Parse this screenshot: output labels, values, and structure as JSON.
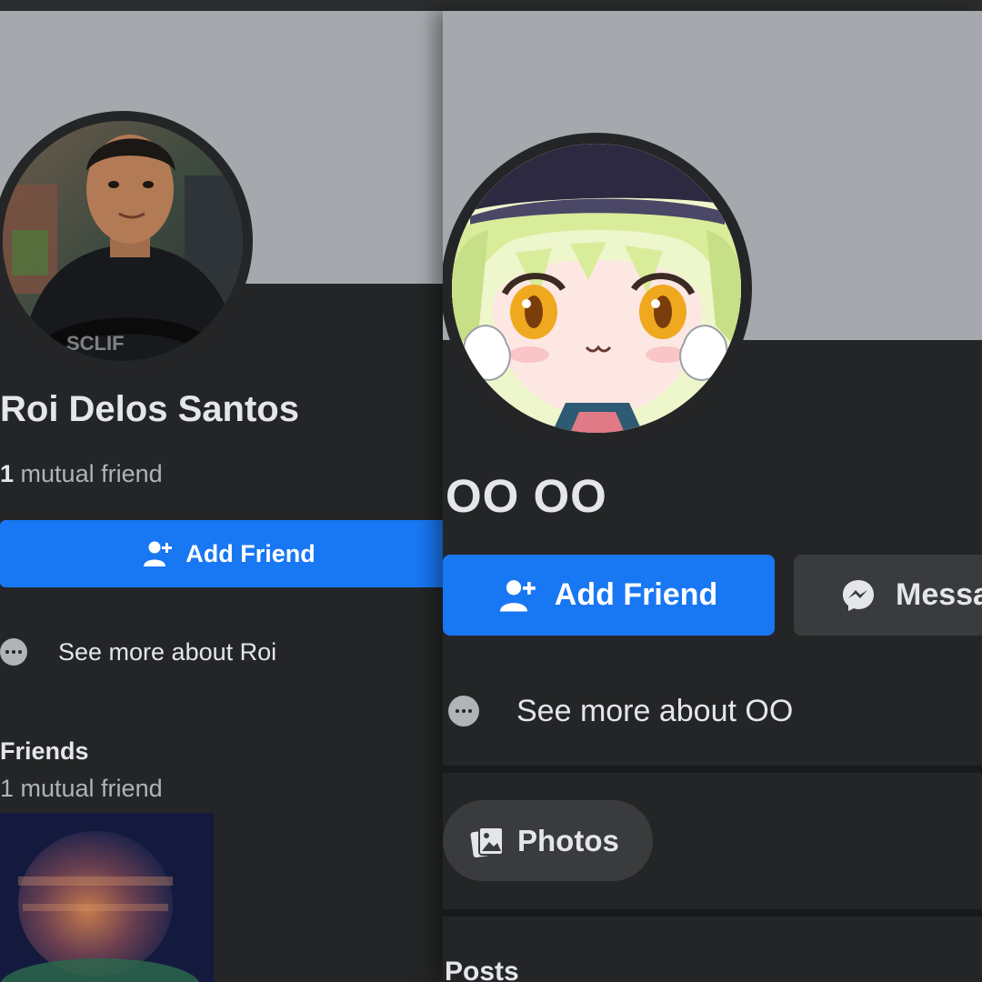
{
  "left_profile": {
    "name": "Roi Delos Santos",
    "mutual_count": "1",
    "mutual_text": "mutual friend",
    "add_friend_label": "Add Friend",
    "see_more_label": "See more about Roi",
    "friends_heading": "Friends",
    "friends_sub": "1 mutual friend"
  },
  "right_profile": {
    "name": "OO OO",
    "add_friend_label": "Add Friend",
    "message_label": "Messa",
    "see_more_label": "See more about OO",
    "photos_label": "Photos",
    "posts_heading": "Posts"
  },
  "colors": {
    "accent": "#1877f2",
    "background": "#242526",
    "cover": "#a5a8ad",
    "secondary_button": "#3a3b3c",
    "text_primary": "#e4e6eb",
    "text_secondary": "#b0b3b8"
  }
}
